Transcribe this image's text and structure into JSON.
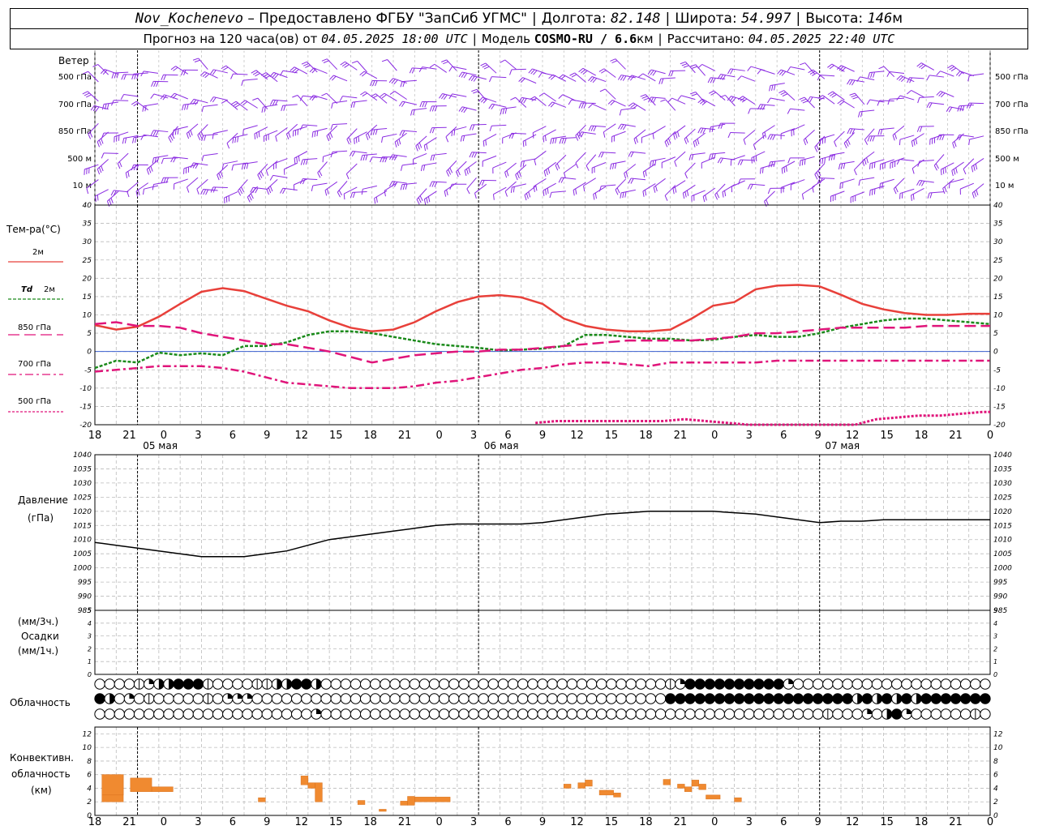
{
  "header": {
    "station": "Nov_Kochenevo",
    "provider": "– Предоставлено ФГБУ \"ЗапСиб УГМС\"",
    "lon_label": "Долгота:",
    "lon": "82.148",
    "lat_label": "Широта:",
    "lat": "54.997",
    "alt_label": "Высота:",
    "alt": "146",
    "alt_unit": "м",
    "forecast_prefix": "Прогноз на 120 часа(ов) от",
    "forecast_time": "04.05.2025 18:00 UTC",
    "model_label": "Модель",
    "model": "COSMO-RU / 6.6",
    "model_unit": "км",
    "calc_label": "Рассчитано:",
    "calc_time": "04.05.2025 22:40 UTC"
  },
  "labels": {
    "wind": "Ветер",
    "temp": "Тем-ра(°С)",
    "t2m": "2м",
    "td": "Td",
    "td2m": "2м",
    "l850": "850 гПа",
    "l700": "700 гПа",
    "l500": "500 гПа",
    "pressure1": "Давление",
    "pressure2": "(гПа)",
    "precip1": "(мм/3ч.)",
    "precip2": "Осадки",
    "precip3": "(мм/1ч.)",
    "cloud": "Облачность",
    "conv1": "Конвективн.",
    "conv2": "облачность",
    "conv3": "(км)"
  },
  "wind_levels": [
    "500 гПа",
    "700 гПа",
    "850 гПа",
    "500 м",
    "10 м"
  ],
  "colors": {
    "t2m": "#e8403a",
    "td": "#1a8a1a",
    "t850": "#e0157a",
    "t700": "#e0157a",
    "t500": "#e0157a",
    "wind": "#8a2be2",
    "conv": "#f08a30"
  },
  "chart_data": [
    {
      "type": "line",
      "title": "Температура",
      "x_hours": [
        0,
        3,
        6,
        9,
        12,
        15,
        18,
        21,
        24,
        27,
        30,
        33,
        36,
        39,
        42,
        45,
        48,
        51,
        54,
        57,
        60,
        63,
        66,
        69,
        72,
        75,
        78,
        81,
        84,
        87,
        90,
        93,
        96,
        99,
        102,
        105,
        108,
        111,
        114,
        117,
        120,
        123,
        126
      ],
      "date_labels": [
        "05 мая",
        "06 мая",
        "07 мая"
      ],
      "ylim": [
        -20,
        40
      ],
      "series": [
        {
          "name": "2м",
          "values": [
            7.2,
            6,
            6.8,
            9.5,
            13,
            16.3,
            17.3,
            16.5,
            14.5,
            12.5,
            11,
            8.5,
            6.5,
            5.5,
            6,
            8,
            11,
            13.5,
            15,
            15.4,
            14.8,
            13,
            9,
            7,
            6,
            5.5,
            5.5,
            6,
            9,
            12.5,
            13.5,
            17,
            18,
            18.2,
            17.8,
            15.5,
            13,
            11.5,
            10.5,
            10,
            10,
            10.3,
            10.3
          ]
        },
        {
          "name": "Td 2м",
          "values": [
            -4.5,
            -2.5,
            -3,
            -0.3,
            -1,
            -0.5,
            -1,
            1.5,
            1.5,
            2.5,
            4.5,
            5.5,
            5.5,
            5,
            4,
            3,
            2,
            1.5,
            1,
            0.3,
            0.5,
            0.8,
            1.5,
            4.5,
            4.5,
            4,
            3.5,
            3.5,
            3,
            3.2,
            4,
            4.5,
            4,
            4,
            5,
            6.5,
            7.5,
            8.5,
            9,
            9,
            8.5,
            8,
            7.5
          ]
        },
        {
          "name": "850 гПа",
          "values": [
            7.5,
            8,
            7,
            7,
            6.5,
            5,
            4,
            3,
            2,
            2,
            1,
            0,
            -1.5,
            -3,
            -2,
            -1,
            -0.5,
            0,
            0,
            0.5,
            0.5,
            1,
            1.5,
            2,
            2.5,
            3,
            3,
            3,
            3,
            3.5,
            4,
            5,
            5,
            5.5,
            6,
            6.5,
            6.5,
            6.5,
            6.5,
            7,
            7,
            7,
            7
          ]
        },
        {
          "name": "700 гПа",
          "values": [
            -5.5,
            -5,
            -4.5,
            -4,
            -4,
            -4,
            -4.5,
            -5.5,
            -7,
            -8.5,
            -9,
            -9.5,
            -10,
            -10,
            -10,
            -9.5,
            -8.5,
            -8,
            -7,
            -6,
            -5,
            -4.5,
            -3.5,
            -3,
            -3,
            -3.5,
            -4,
            -3,
            -3,
            -3,
            -3,
            -3,
            -2.5,
            -2.5,
            -2.5,
            -2.5,
            -2.5,
            -2.5,
            -2.5,
            -2.5,
            -2.5,
            -2.5,
            -2.5
          ]
        },
        {
          "name": "500 гПа",
          "x_hours": [
            62,
            65,
            68,
            71,
            74,
            77,
            80,
            83,
            86,
            89,
            92,
            95,
            98,
            101,
            104,
            107,
            110,
            113,
            116,
            119,
            122,
            125,
            126
          ],
          "values": [
            -19.5,
            -19,
            -19,
            -19,
            -19,
            -19,
            -19,
            -18.5,
            -19,
            -19.5,
            -20,
            -21,
            -22,
            -22,
            -22,
            -21,
            -18.5,
            -18,
            -17.5,
            -17.5,
            -17,
            -16.5,
            -16.5
          ]
        }
      ]
    },
    {
      "type": "line",
      "title": "Давление (гПа)",
      "ylim": [
        985,
        1040
      ],
      "x_hours": [
        0,
        3,
        6,
        9,
        12,
        15,
        18,
        21,
        24,
        27,
        30,
        33,
        36,
        39,
        42,
        45,
        48,
        51,
        54,
        57,
        60,
        63,
        66,
        69,
        72,
        75,
        78,
        81,
        84,
        87,
        90,
        93,
        96,
        99,
        102,
        105,
        108,
        111,
        114,
        117,
        120,
        123,
        126
      ],
      "series": [
        {
          "name": "Давление",
          "values": [
            1009,
            1008,
            1007,
            1006,
            1005,
            1004,
            1004,
            1004,
            1005,
            1006,
            1008,
            1010,
            1011,
            1012,
            1013,
            1014,
            1015,
            1015.5,
            1015.5,
            1015.5,
            1015.5,
            1016,
            1017,
            1018,
            1019,
            1019.5,
            1020,
            1020,
            1020,
            1020,
            1019.5,
            1019,
            1018,
            1017,
            1016,
            1016.5,
            1016.5,
            1017,
            1017,
            1017,
            1017,
            1017,
            1017
          ]
        }
      ]
    },
    {
      "type": "bar",
      "title": "Конвективн. облачность (км)",
      "ylim": [
        0,
        13
      ],
      "bars": [
        {
          "h0": 1,
          "h1": 4,
          "lo": 2,
          "hi": 6
        },
        {
          "h0": 1,
          "h1": 4,
          "lo": 3,
          "hi": 6
        },
        {
          "h0": 5,
          "h1": 8,
          "lo": 3.5,
          "hi": 5.5
        },
        {
          "h0": 8,
          "h1": 11,
          "lo": 3.5,
          "hi": 4.2
        },
        {
          "h0": 23,
          "h1": 24,
          "lo": 2,
          "hi": 2.6
        },
        {
          "h0": 29,
          "h1": 30,
          "lo": 4.5,
          "hi": 5.8
        },
        {
          "h0": 30,
          "h1": 31,
          "lo": 4,
          "hi": 4.8
        },
        {
          "h0": 31,
          "h1": 32,
          "lo": 2,
          "hi": 4.8
        },
        {
          "h0": 37,
          "h1": 38,
          "lo": 1.6,
          "hi": 2.2
        },
        {
          "h0": 40,
          "h1": 41,
          "lo": 0.6,
          "hi": 0.9
        },
        {
          "h0": 43,
          "h1": 44,
          "lo": 1.5,
          "hi": 2.1
        },
        {
          "h0": 44,
          "h1": 45,
          "lo": 1.5,
          "hi": 2.8
        },
        {
          "h0": 45,
          "h1": 50,
          "lo": 2,
          "hi": 2.7
        },
        {
          "h0": 66,
          "h1": 67,
          "lo": 4,
          "hi": 4.6
        },
        {
          "h0": 68,
          "h1": 69,
          "lo": 4,
          "hi": 4.8
        },
        {
          "h0": 69,
          "h1": 70,
          "lo": 4.3,
          "hi": 5.2
        },
        {
          "h0": 71,
          "h1": 73,
          "lo": 3,
          "hi": 3.7
        },
        {
          "h0": 73,
          "h1": 74,
          "lo": 2.7,
          "hi": 3.3
        },
        {
          "h0": 80,
          "h1": 81,
          "lo": 4.5,
          "hi": 5.3
        },
        {
          "h0": 82,
          "h1": 83,
          "lo": 4,
          "hi": 4.6
        },
        {
          "h0": 83,
          "h1": 84,
          "lo": 3.5,
          "hi": 4.2
        },
        {
          "h0": 84,
          "h1": 85,
          "lo": 4.3,
          "hi": 5.2
        },
        {
          "h0": 85,
          "h1": 86,
          "lo": 3.8,
          "hi": 4.6
        },
        {
          "h0": 86,
          "h1": 88,
          "lo": 2.4,
          "hi": 3
        },
        {
          "h0": 90,
          "h1": 91,
          "lo": 2,
          "hi": 2.6
        }
      ]
    }
  ],
  "precip": {
    "ylim": [
      0,
      5
    ]
  },
  "cloud_rows": [
    "0000123344410000113344300000000000000000000000000000000000124444444444200000000000000000000",
    "4302010000010222000000000000000000000000000000000000000000444444444444444444434343434444444",
    "0000000000000000000000200000000000000000000000000000000000000000000000000010002034200000010"
  ],
  "x_axis": {
    "tick_labels": [
      "18",
      "21",
      "0",
      "3",
      "6",
      "9",
      "12",
      "15",
      "18",
      "21",
      "0",
      "3",
      "6",
      "9",
      "12",
      "15",
      "18",
      "21",
      "0",
      "3",
      "6",
      "9",
      "12",
      "15",
      "18",
      "21",
      "0"
    ]
  }
}
